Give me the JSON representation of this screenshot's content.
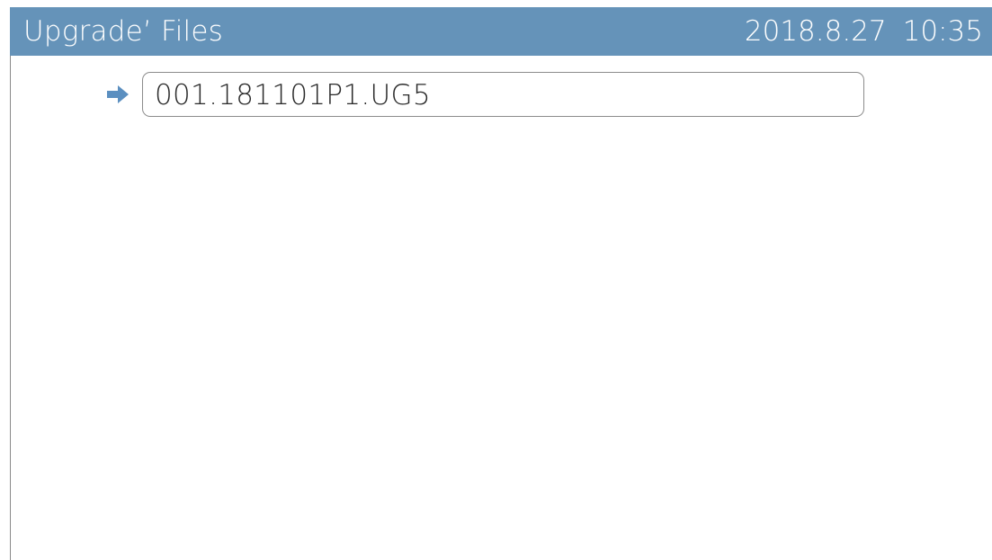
{
  "header": {
    "title": "Upgrade’ Files",
    "date": "2018.8.27",
    "time": "10:35",
    "background_color": "#6593b9"
  },
  "file_list": {
    "selected_index": 0,
    "items": [
      {
        "name": "001.181101P1.UG5",
        "icon": "arrow-right-icon"
      }
    ]
  },
  "colors": {
    "accent": "#5b8fc0"
  }
}
